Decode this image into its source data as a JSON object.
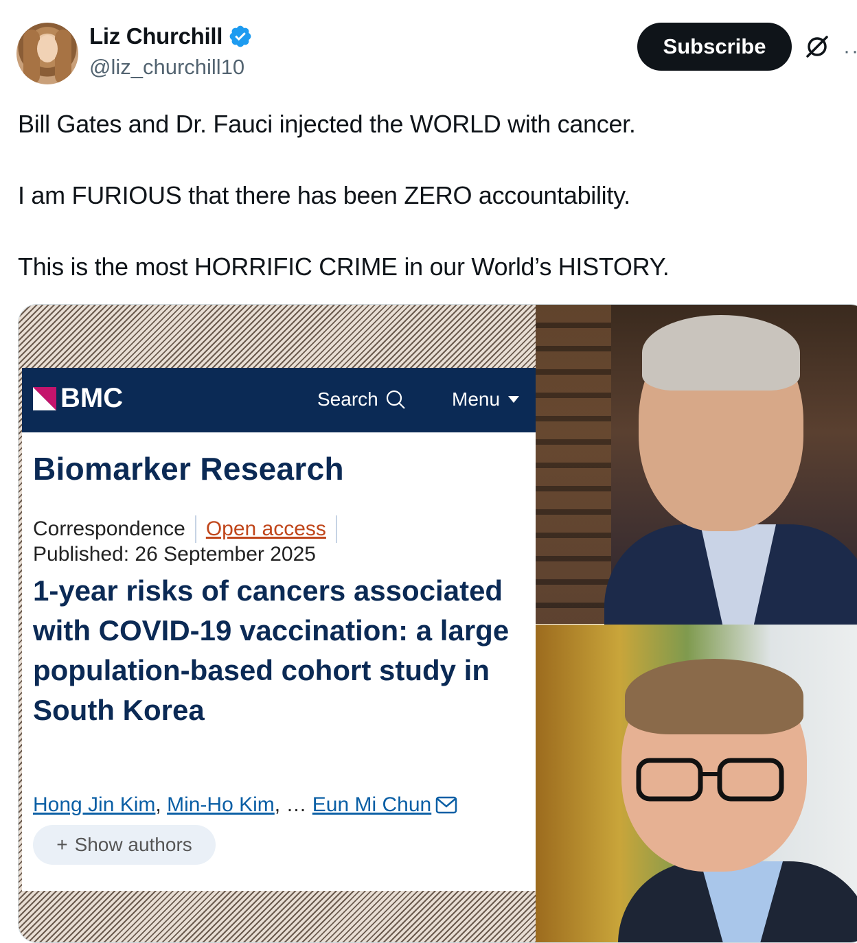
{
  "author": {
    "name": "Liz Churchill",
    "handle": "@liz_churchill10"
  },
  "actions": {
    "subscribe_label": "Subscribe",
    "grok_icon": "grok-icon",
    "more_icon": "more-icon"
  },
  "tweet": {
    "paragraphs": [
      "Bill Gates and Dr. Fauci injected the WORLD with cancer.",
      "I am FURIOUS that there has been ZERO accountability.",
      "This is the most HORRIFIC CRIME in our World’s HISTORY."
    ]
  },
  "media": {
    "bmc": {
      "logo": "BMC",
      "search_label": "Search",
      "menu_label": "Menu",
      "journal": "Biomarker Research",
      "article_type": "Correspondence",
      "access": "Open access",
      "published": "Published: 26 September 2025",
      "title": "1-year risks of cancers associated with COVID-19 vaccination: a large population-based cohort study in South Korea",
      "authors": [
        "Hong Jin Kim",
        "Min-Ho Kim",
        "Eun Mi Chun"
      ],
      "author_sep_1": ",",
      "author_ellipsis": ", …",
      "show_authors": "Show authors"
    }
  },
  "colors": {
    "verified": "#1d9bf0",
    "bmc_navy": "#0b2a55",
    "open_access": "#c0461b",
    "link": "#0b5fa5"
  }
}
